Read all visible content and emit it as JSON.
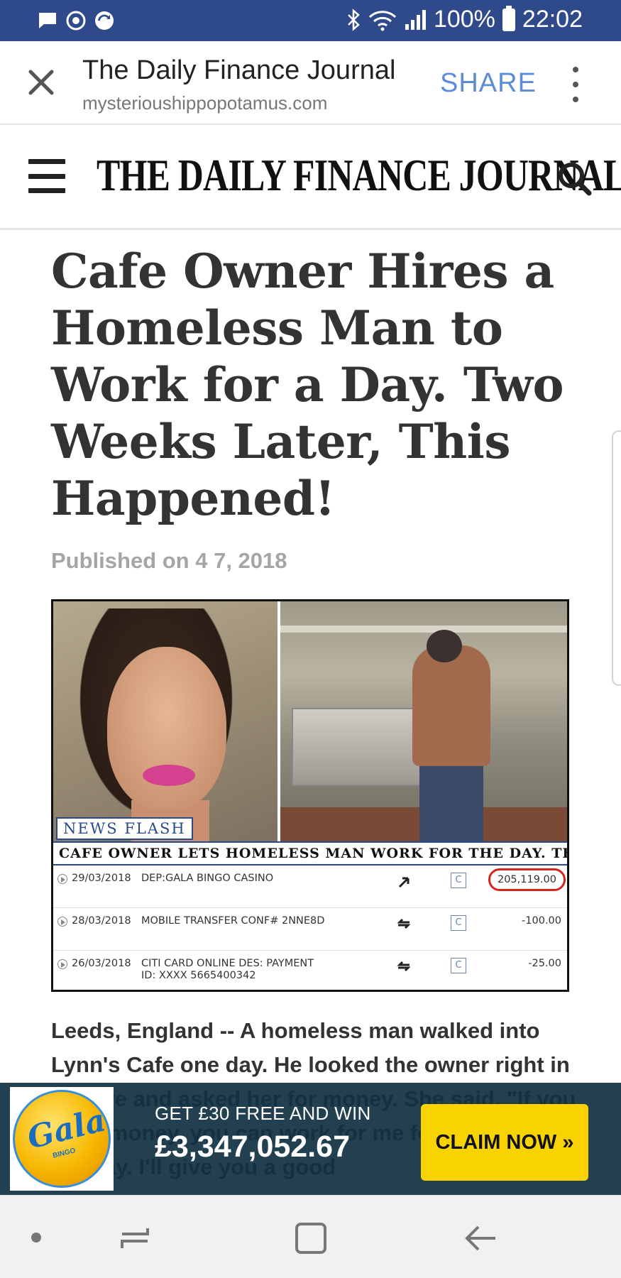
{
  "status_bar": {
    "battery": "100%",
    "time": "22:02"
  },
  "custom_tab": {
    "title": "The Daily Finance Journal",
    "url": "mysterioushippopotamus.com",
    "share_label": "SHARE"
  },
  "site": {
    "logo": "THE DAILY FINANCE JOURNAL"
  },
  "article": {
    "headline": "Cafe Owner Hires a Homeless Man to Work for a Day. Two Weeks Later, This Happened!",
    "published": "Published on 4 7, 2018",
    "figure": {
      "news_flash": "NEWS FLASH",
      "ticker": "CAFE OWNER LETS HOMELESS MAN WORK FOR THE DAY. THIS HAPI",
      "transactions": [
        {
          "date": "29/03/2018",
          "description": "DEP:GALA BINGO CASINO",
          "icon": "C",
          "amount": "205,119.00"
        },
        {
          "date": "28/03/2018",
          "description": "MOBILE TRANSFER CONF# 2NNE8D",
          "icon": "C",
          "amount": "-100.00"
        },
        {
          "date": "26/03/2018",
          "description": "CITI CARD ONLINE DES: PAYMENT ID: XXXX 5665400342",
          "icon": "C",
          "amount": "-25.00"
        }
      ]
    },
    "body": "Leeds, England -- A homeless man walked into Lynn's Cafe one day. He looked the owner right in the eye and asked her for money. She said, \"If you need money, you can work for me for the rest of the day. I'll give you a good"
  },
  "ad": {
    "logo_text": "Gala",
    "logo_sub": "BINGO",
    "line1": "GET £30 FREE AND WIN",
    "line2": "£3,347,052.67",
    "cta": "CLAIM NOW »"
  },
  "colors": {
    "status_bar": "#2f4a8a",
    "share": "#5b8bd9",
    "ad_background": "#113242",
    "cta": "#f8d300",
    "circle_highlight": "#d6251d"
  }
}
